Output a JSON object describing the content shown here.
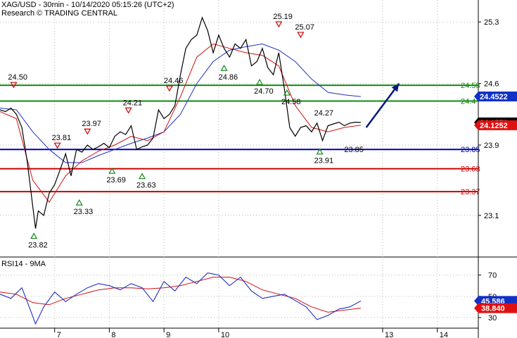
{
  "header": {
    "title": "XAG/USD - 30min - 10/14/2020 05:15:26 (UTC+2)",
    "subtitle": "Research © TRADING CENTRAL"
  },
  "indicator": {
    "title": "RSI14 - 9MA"
  },
  "colors": {
    "price": "#000000",
    "ma_fast": "#d01010",
    "ma_slow": "#2030c0",
    "resistance": "#138a13",
    "support": "#cc0000",
    "pivot": "#0000aa",
    "arrow": "#0a1a7a",
    "badge_price": "#000000",
    "badge_fast": "#e01010",
    "badge_slow": "#1030c8",
    "grid": "#b8b8b8"
  },
  "chart_data": {
    "type": "line",
    "title": "XAG/USD - 30min - 10/14/2020 05:15:26 (UTC+2)",
    "y_range": [
      22.65,
      25.55
    ],
    "y_ticks": [
      "25.3",
      "24.6",
      "23.9",
      "23.1"
    ],
    "x_range": [
      6.0,
      14.75
    ],
    "x_ticks": [
      "7",
      "8",
      "9",
      "10",
      "13",
      "14"
    ],
    "grid": true,
    "series": [
      {
        "name": "XAG/USD",
        "x": [
          6.0,
          6.1,
          6.2,
          6.3,
          6.4,
          6.5,
          6.6,
          6.65,
          6.7,
          6.8,
          6.9,
          7.0,
          7.1,
          7.2,
          7.3,
          7.4,
          7.5,
          7.6,
          7.7,
          7.8,
          7.9,
          8.0,
          8.1,
          8.2,
          8.3,
          8.4,
          8.5,
          8.6,
          8.7,
          8.8,
          8.9,
          9.0,
          9.1,
          9.2,
          9.3,
          9.4,
          9.5,
          9.6,
          9.7,
          9.8,
          9.9,
          10.0,
          10.1,
          10.2,
          10.3,
          10.4,
          10.5,
          10.6,
          10.7,
          10.8,
          10.9,
          11.0,
          11.1,
          11.2,
          11.3,
          11.4,
          11.5,
          11.6,
          11.7,
          11.8,
          11.9,
          12.0,
          12.1,
          12.2,
          12.3,
          12.4,
          12.5,
          12.6
        ],
        "y": [
          24.3,
          24.28,
          24.32,
          24.25,
          24.1,
          23.7,
          23.2,
          22.95,
          23.15,
          23.1,
          23.35,
          23.45,
          23.62,
          23.8,
          23.55,
          23.85,
          23.82,
          23.9,
          23.85,
          23.88,
          23.92,
          23.87,
          24.0,
          24.05,
          24.02,
          24.12,
          23.85,
          23.88,
          23.9,
          23.98,
          24.3,
          24.2,
          24.25,
          24.35,
          24.7,
          25.0,
          25.1,
          25.15,
          25.35,
          25.2,
          24.95,
          25.15,
          25.0,
          24.9,
          25.05,
          25.0,
          25.1,
          24.8,
          24.85,
          25.0,
          24.78,
          24.7,
          24.95,
          24.55,
          24.1,
          24.0,
          24.1,
          24.12,
          24.05,
          24.15,
          23.95,
          24.12,
          24.14,
          24.16,
          24.12,
          24.15,
          24.16,
          24.157
        ]
      },
      {
        "name": "",
        "x": [
          6.0,
          6.3,
          6.6,
          6.9,
          7.2,
          7.5,
          7.8,
          8.1,
          8.4,
          8.7,
          9.0,
          9.3,
          9.6,
          9.9,
          10.2,
          10.5,
          10.8,
          11.1,
          11.4,
          11.7,
          12.0,
          12.3,
          12.6
        ],
        "y": [
          24.28,
          24.2,
          23.5,
          23.25,
          23.55,
          23.72,
          23.83,
          23.9,
          24.0,
          23.95,
          24.05,
          24.45,
          24.9,
          25.05,
          25.0,
          24.95,
          24.92,
          24.8,
          24.35,
          24.1,
          24.05,
          24.1,
          24.125
        ]
      },
      {
        "name": "",
        "x": [
          6.0,
          6.3,
          6.6,
          6.9,
          7.2,
          7.5,
          7.8,
          8.1,
          8.4,
          8.7,
          9.0,
          9.3,
          9.6,
          9.9,
          10.2,
          10.5,
          10.8,
          11.1,
          11.4,
          11.7,
          12.0,
          12.3,
          12.6
        ],
        "y": [
          24.32,
          24.3,
          24.05,
          23.85,
          23.7,
          23.7,
          23.78,
          23.85,
          23.92,
          23.98,
          24.05,
          24.25,
          24.6,
          24.85,
          24.98,
          25.02,
          25.05,
          24.98,
          24.85,
          24.65,
          24.5,
          24.47,
          24.452
        ]
      }
    ],
    "levels": [
      {
        "kind": "resistance",
        "value": 24.58,
        "label": "24.58"
      },
      {
        "kind": "resistance",
        "value": 24.4,
        "label": "24.4"
      },
      {
        "kind": "pivot",
        "value": 23.85,
        "label": "23.85"
      },
      {
        "kind": "support",
        "value": 23.63,
        "label": "23.63"
      },
      {
        "kind": "support",
        "value": 23.37,
        "label": "23.37"
      }
    ],
    "badges": [
      {
        "value": 24.4522,
        "label": "24.4522",
        "series": "slow"
      },
      {
        "value": 24.1572,
        "label": "24.1572",
        "series": "price"
      },
      {
        "value": 24.1252,
        "label": "24.1252",
        "series": "fast"
      }
    ],
    "annotations": [
      {
        "label": "24.50",
        "x": 6.25,
        "y": 24.5,
        "dir": "down"
      },
      {
        "label": "23.82",
        "x": 6.62,
        "y": 22.95,
        "dir": "up"
      },
      {
        "label": "23.81",
        "x": 7.05,
        "y": 23.81,
        "dir": "down"
      },
      {
        "label": "23.33",
        "x": 7.45,
        "y": 23.33,
        "dir": "up"
      },
      {
        "label": "23.97",
        "x": 7.6,
        "y": 23.97,
        "dir": "down"
      },
      {
        "label": "23.69",
        "x": 8.05,
        "y": 23.69,
        "dir": "up"
      },
      {
        "label": "24.21",
        "x": 8.35,
        "y": 24.21,
        "dir": "down"
      },
      {
        "label": "23.63",
        "x": 8.6,
        "y": 23.63,
        "dir": "up"
      },
      {
        "label": "24.46",
        "x": 9.1,
        "y": 24.46,
        "dir": "down"
      },
      {
        "label": "24.86",
        "x": 10.1,
        "y": 24.86,
        "dir": "up"
      },
      {
        "label": "24.70",
        "x": 10.75,
        "y": 24.7,
        "dir": "up"
      },
      {
        "label": "25.19",
        "x": 11.1,
        "y": 25.19,
        "dir": "down"
      },
      {
        "label": "24.58",
        "x": 11.25,
        "y": 24.58,
        "dir": "up"
      },
      {
        "label": "25.07",
        "x": 11.5,
        "y": 25.07,
        "dir": "down"
      },
      {
        "label": "24.27",
        "x": 11.85,
        "y": 24.27,
        "dir": "none"
      },
      {
        "label": "23.91",
        "x": 11.85,
        "y": 23.91,
        "dir": "up"
      },
      {
        "label": "23.85",
        "x": 12.4,
        "y": 23.85,
        "dir": "none"
      }
    ],
    "forecast_arrow": {
      "from": [
        12.7,
        24.1
      ],
      "to": [
        13.3,
        24.6
      ]
    },
    "rsi": {
      "title": "RSI14 - 9MA",
      "y_range": [
        20,
        85
      ],
      "y_ticks": [
        "70",
        "50",
        "30"
      ],
      "badges": [
        {
          "value": 45.586,
          "label": "45.586",
          "series": "rsi"
        },
        {
          "value": 38.84,
          "label": "38.840",
          "series": "ma"
        }
      ],
      "rsi_x": [
        6.0,
        6.2,
        6.4,
        6.55,
        6.65,
        6.8,
        7.0,
        7.2,
        7.4,
        7.6,
        7.8,
        8.0,
        8.2,
        8.4,
        8.6,
        8.8,
        9.0,
        9.2,
        9.4,
        9.6,
        9.8,
        10.0,
        10.2,
        10.4,
        10.6,
        10.8,
        11.0,
        11.2,
        11.4,
        11.6,
        11.8,
        12.0,
        12.2,
        12.4,
        12.6
      ],
      "rsi_y": [
        52,
        48,
        58,
        38,
        24,
        40,
        54,
        45,
        52,
        58,
        62,
        60,
        56,
        62,
        58,
        45,
        64,
        55,
        68,
        62,
        72,
        70,
        60,
        68,
        55,
        48,
        50,
        52,
        46,
        40,
        28,
        32,
        38,
        40,
        45.586
      ],
      "ma_x": [
        6.0,
        6.3,
        6.6,
        6.9,
        7.2,
        7.5,
        7.8,
        8.1,
        8.4,
        8.7,
        9.0,
        9.3,
        9.6,
        9.9,
        10.2,
        10.5,
        10.8,
        11.1,
        11.4,
        11.7,
        12.0,
        12.3,
        12.6
      ],
      "ma_y": [
        54,
        52,
        44,
        42,
        48,
        52,
        56,
        58,
        58,
        57,
        58,
        60,
        64,
        68,
        68,
        64,
        56,
        52,
        48,
        40,
        35,
        37,
        38.84
      ]
    }
  }
}
